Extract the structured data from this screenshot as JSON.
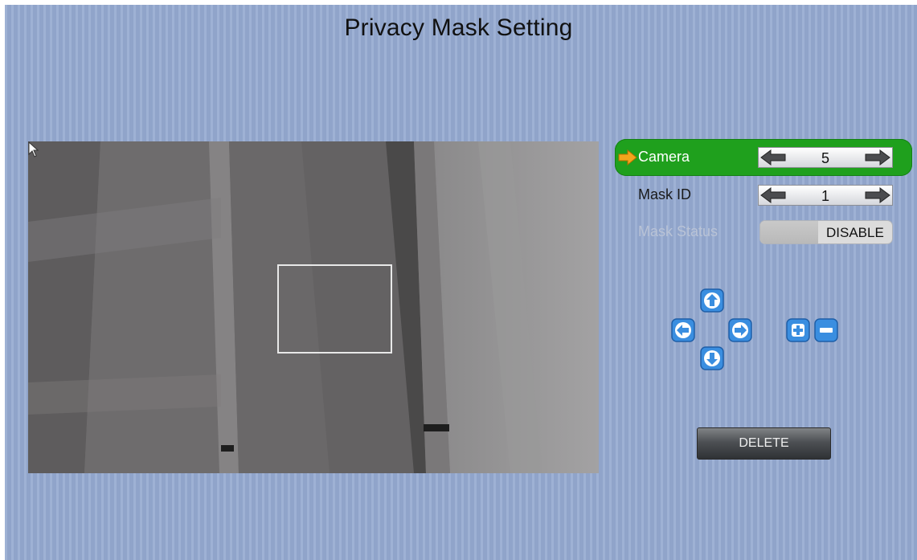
{
  "page": {
    "title": "Privacy Mask Setting"
  },
  "settings": {
    "camera": {
      "label": "Camera",
      "value": "5",
      "selected": true
    },
    "mask_id": {
      "label": "Mask ID",
      "value": "1"
    },
    "mask_status": {
      "label": "Mask Status",
      "value": "DISABLE",
      "enabled": false
    }
  },
  "controls": {
    "move": [
      "up-arrow-icon",
      "left-arrow-icon",
      "right-arrow-icon",
      "down-arrow-icon"
    ],
    "resize": [
      "plus-icon",
      "minus-icon"
    ]
  },
  "actions": {
    "delete_label": "DELETE"
  },
  "colors": {
    "background": "#93a8cf",
    "selection": "#1fa01d",
    "selector_arrow": "#f4a51c",
    "nav_button": "#3a8ee0"
  }
}
